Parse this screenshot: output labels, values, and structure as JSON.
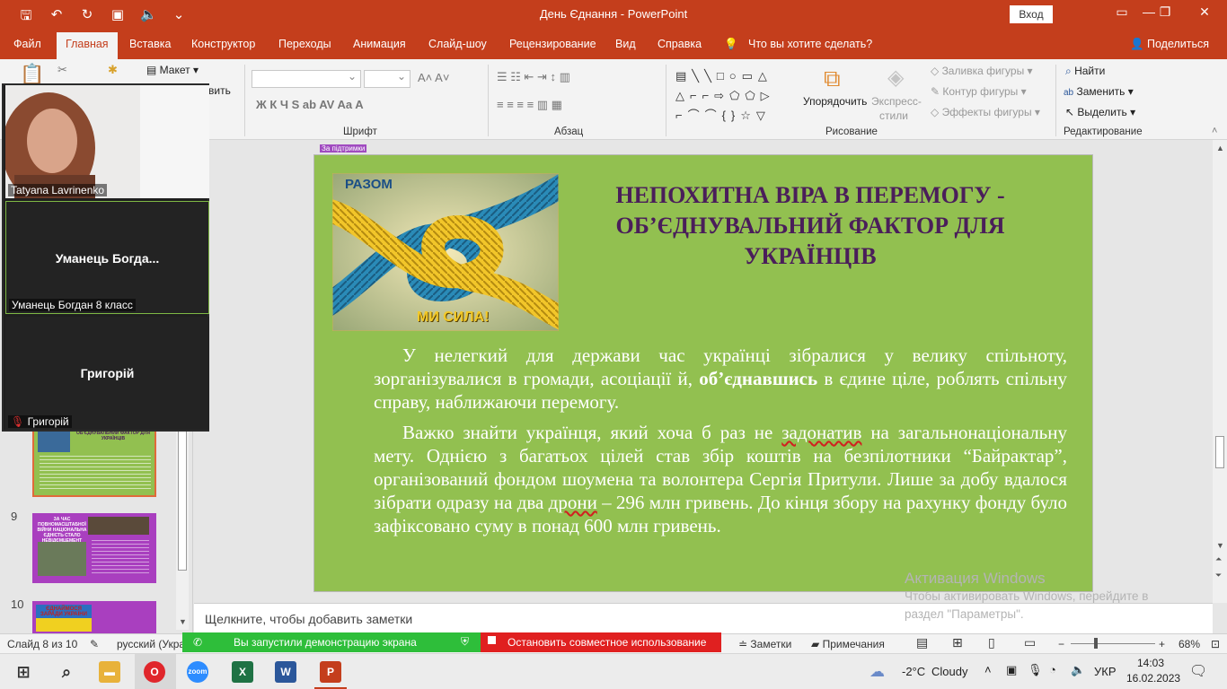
{
  "window": {
    "title": "День Єднання  -  PowerPoint",
    "signin": "Вход"
  },
  "tabs": [
    {
      "label": "Файл"
    },
    {
      "label": "Главная"
    },
    {
      "label": "Вставка"
    },
    {
      "label": "Конструктор"
    },
    {
      "label": "Переходы"
    },
    {
      "label": "Анимация"
    },
    {
      "label": "Слайд-шоу"
    },
    {
      "label": "Рецензирование"
    },
    {
      "label": "Вид"
    },
    {
      "label": "Справка"
    },
    {
      "label": "Что вы хотите сделать?"
    },
    {
      "label": "Поделиться"
    }
  ],
  "ribbon": {
    "groups": {
      "font": "Шрифт",
      "paragraph": "Абзац",
      "drawing": "Рисование",
      "editing": "Редактирование"
    },
    "layout_label": "Макет",
    "paste_fragment": "вить",
    "arrange": "Упорядочить",
    "quick_styles_1": "Экспресс-",
    "quick_styles_2": "стили",
    "shape_fill": "Заливка фигуры",
    "shape_outline": "Контур фигуры",
    "shape_effects": "Эффекты фигуры",
    "find": "Найти",
    "replace": "Заменить",
    "select": "Выделить",
    "font_buttons": "Ж  К  Ч  S  ab  AV  Aa  A"
  },
  "zoom_call": {
    "participants": [
      {
        "name": "Tatyana Lavrinenko"
      },
      {
        "display": "Уманець  Богда...",
        "name": "Уманець Богдан 8 класс"
      },
      {
        "display": "Григорій",
        "name": "Григорій"
      }
    ]
  },
  "slides_panel": {
    "numbers": [
      "9",
      "10"
    ],
    "thumb8_title": "ОБ'ЄДНУВАЛЬНИЙ ФАКТОР ДЛЯ УКРАЇНЦІВ",
    "thumb9_title": "ЗА ЧАС ПОВНОМАСШТАБНОЇ ВІЙНИ НАЦІОНАЛЬНА ЄДНІСТЬ СТАЛО НЕВІДЄМЦЕМЕНТ",
    "thumb10_text": "ЄДНАЙМОСЯ ЗАРАДИ УКРАЇНИ"
  },
  "slide": {
    "cursor_note": "За підтримки",
    "image_text_top": "РАЗОМ",
    "image_text_bottom": "МИ СИЛА!",
    "title": "НЕПОХИТНА ВІРА В ПЕРЕМОГУ - ОБ’ЄДНУВАЛЬНИЙ ФАКТОР  ДЛЯ УКРАЇНЦІВ",
    "p1_a": "У нелегкий для держави час українці зібралися у велику спільноту, зорганізувалися в громади, асоціації й, ",
    "p1_bold": "об’єднавшись",
    "p1_b": " в єдине ціле, роблять спільну справу, наближаючи перемогу.",
    "p2_a": "Важко знайти українця, який хоча б раз не ",
    "p2_sq1": "задонатив",
    "p2_b": " на загальнонаціональну мету. Однією з багатьох цілей став збір коштів на безпілотники “Байрактар”, організований фондом шоумена та волонтера Сергія Притули. Лише за добу вдалося зібрати одразу на два ",
    "p2_sq2": "дрони",
    "p2_c": " – 296 млн гривень. До кінця збору на рахунку фонду було зафіксовано суму в понад 600 млн гривень."
  },
  "notes_placeholder": "Щелкните, чтобы добавить заметки",
  "activation": {
    "line1": "Активация Windows",
    "line2": "Чтобы активировать Windows, перейдите в",
    "line3": "раздел \"Параметры\"."
  },
  "status": {
    "slide_counter": "Слайд 8 из 10",
    "language": "русский (Укра",
    "sharing": "Вы запустили демонстрацию экрана",
    "stop_sharing": "Остановить совместное использование",
    "notes": "Заметки",
    "comments": "Примечания",
    "zoom": "68%"
  },
  "taskbar": {
    "weather_temp": "-2°C",
    "weather_text": "Cloudy",
    "lang": "УКР",
    "time": "14:03",
    "date": "16.02.2023",
    "zoom_app": "zoom"
  },
  "colors": {
    "accent": "#c43e1c",
    "slide_bg": "#92c050",
    "title_color": "#4a1e5a",
    "thumb_purple": "#a93fbf"
  }
}
